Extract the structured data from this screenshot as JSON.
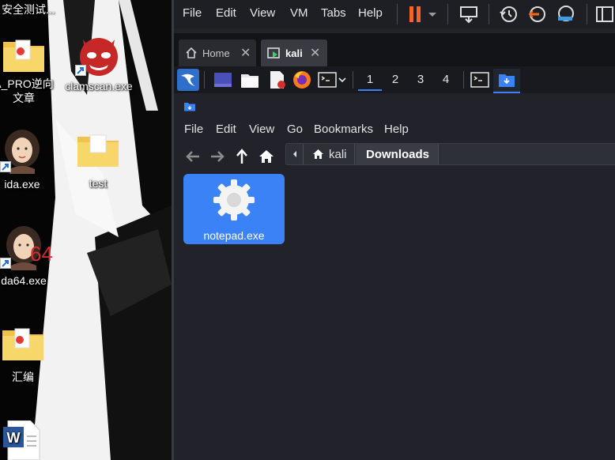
{
  "desktop": {
    "cut_title": "安全测试...",
    "icons": [
      {
        "label": "A_PRO逆向\n文章"
      },
      {
        "label": "clamscan.exe"
      },
      {
        "label": "ida.exe"
      },
      {
        "label": "test"
      },
      {
        "label": "da64.exe"
      },
      {
        "label": "汇编"
      }
    ],
    "ida64_badge": "64"
  },
  "vmware": {
    "menu": [
      "File",
      "Edit",
      "View",
      "VM",
      "Tabs",
      "Help"
    ],
    "tabs": [
      {
        "label": "Home",
        "icon": "home-icon"
      },
      {
        "label": "kali",
        "icon": "vm-running-icon"
      }
    ],
    "colors": {
      "pause": "#f26522",
      "accent": "#3b82f6"
    }
  },
  "kali": {
    "workspaces": [
      "1",
      "2",
      "3",
      "4"
    ],
    "filemanager": {
      "menu": [
        "File",
        "Edit",
        "View",
        "Go",
        "Bookmarks",
        "Help"
      ],
      "path": [
        "kali",
        "Downloads"
      ],
      "files": [
        {
          "name": "notepad.exe",
          "icon": "gear-icon"
        }
      ]
    }
  }
}
